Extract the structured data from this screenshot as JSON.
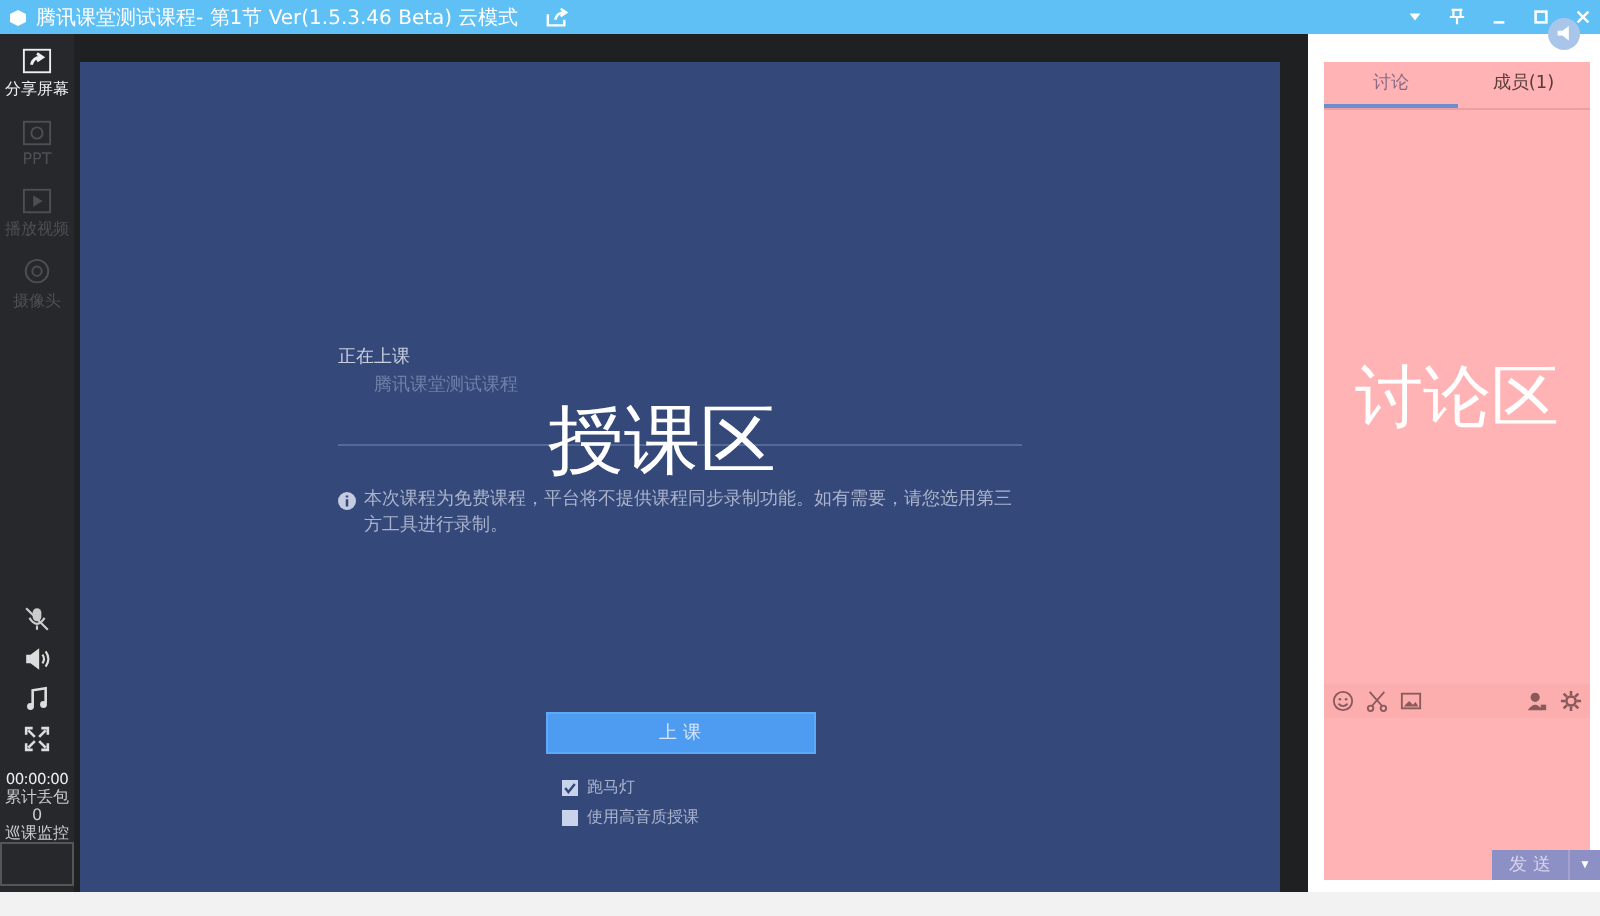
{
  "window": {
    "title": "腾讯课堂测试课程- 第1节 Ver(1.5.3.46 Beta)  云模式"
  },
  "sidebar": {
    "tools": [
      {
        "label": "分享屏幕",
        "kind": "share",
        "disabled": false
      },
      {
        "label": "PPT",
        "kind": "ppt",
        "disabled": true
      },
      {
        "label": "播放视频",
        "kind": "video",
        "disabled": true
      },
      {
        "label": "摄像头",
        "kind": "camera",
        "disabled": true
      }
    ],
    "controls": [
      {
        "kind": "mic"
      },
      {
        "kind": "speaker"
      },
      {
        "kind": "music"
      },
      {
        "kind": "fullscreen"
      }
    ],
    "timer": "00:00:00",
    "loss_label": "累计丢包",
    "loss_value": "0",
    "monitor_label": "巡课监控"
  },
  "stage": {
    "status": "正在上课",
    "course": "腾讯课堂测试课程",
    "overlay_label": "授课区",
    "notice": "本次课程为免费课程，平台将不提供课程同步录制功能。如有需要，请您选用第三方工具进行录制。",
    "start_button": "上  课",
    "options": [
      {
        "label": "跑马灯",
        "checked": true
      },
      {
        "label": "使用高音质授课",
        "checked": false
      }
    ]
  },
  "chat": {
    "tabs": [
      {
        "label": "讨论",
        "selected": true
      },
      {
        "label": "成员(1)",
        "selected": false
      }
    ],
    "overlay_label": "讨论区",
    "send_button": "发 送",
    "send_caret": "▼"
  }
}
